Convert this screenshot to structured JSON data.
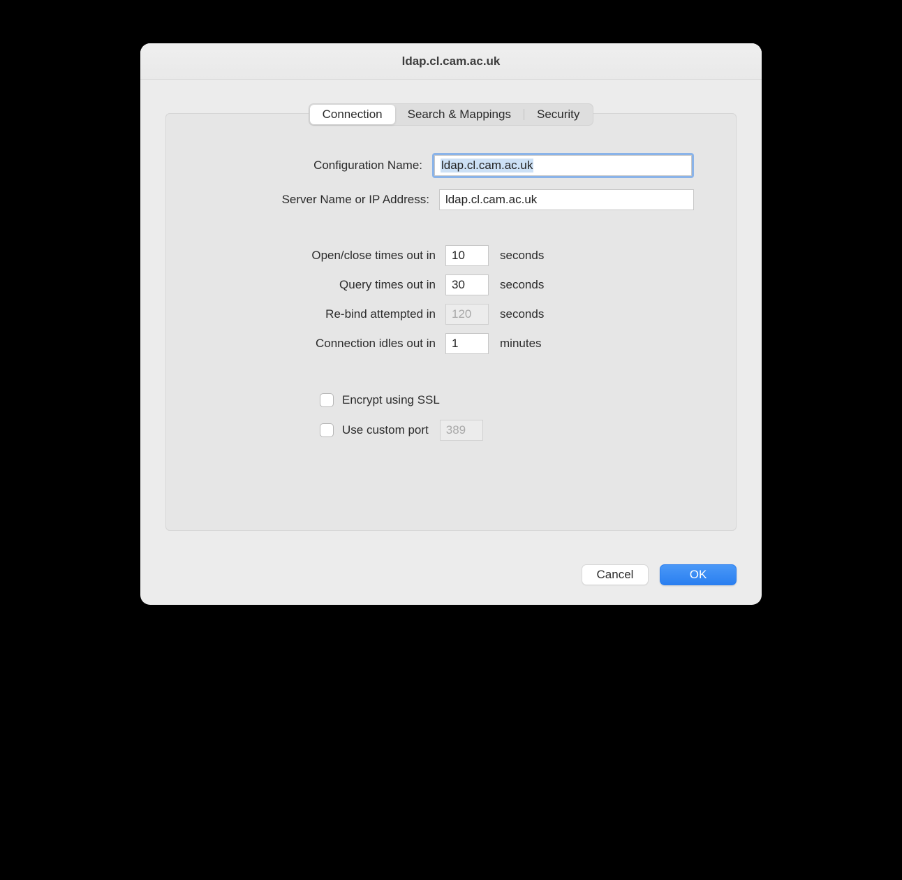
{
  "title": "ldap.cl.cam.ac.uk",
  "tabs": {
    "connection": "Connection",
    "search_mappings": "Search & Mappings",
    "security": "Security"
  },
  "labels": {
    "config_name": "Configuration Name:",
    "server": "Server Name or IP Address:",
    "open_close": "Open/close times out in",
    "query": "Query times out in",
    "rebind": "Re-bind attempted in",
    "idle": "Connection idles out in",
    "seconds": "seconds",
    "minutes": "minutes",
    "ssl": "Encrypt using SSL",
    "custom_port": "Use custom port"
  },
  "values": {
    "config_name": "ldap.cl.cam.ac.uk",
    "server": "ldap.cl.cam.ac.uk",
    "open_close": "10",
    "query": "30",
    "rebind": "120",
    "idle": "1",
    "port": "389"
  },
  "buttons": {
    "cancel": "Cancel",
    "ok": "OK"
  }
}
